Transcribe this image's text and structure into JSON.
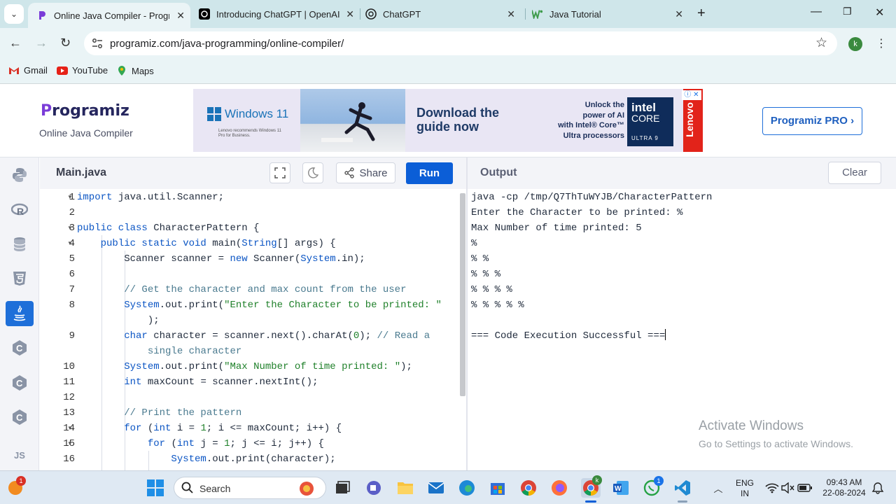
{
  "browser": {
    "tabs": [
      {
        "title": "Online Java Compiler - Program",
        "active": true
      },
      {
        "title": "Introducing ChatGPT | OpenAI",
        "active": false
      },
      {
        "title": "ChatGPT",
        "active": false
      },
      {
        "title": "Java Tutorial",
        "active": false
      }
    ],
    "url": "programiz.com/java-programming/online-compiler/",
    "profile_initial": "k",
    "bookmarks": [
      "Gmail",
      "YouTube",
      "Maps"
    ]
  },
  "site": {
    "logo_text": "rogramiz",
    "logo_letter": "P",
    "subtitle": "Online Java Compiler",
    "pro_button": "Programiz PRO ›",
    "ad": {
      "brand": "Windows 11",
      "brand_sub": "Lenovo recommends Windows 11 Pro for Business.",
      "headline_1": "Download the",
      "headline_2": "guide now",
      "intel_lines": [
        "Unlock the",
        "power of AI",
        "with Intel® Core™",
        "Ultra processors"
      ],
      "intel_logo_1": "intel",
      "intel_logo_2": "CORE",
      "intel_logo_3": "ULTRA 9",
      "lenovo": "Lenovo"
    }
  },
  "editor": {
    "filename": "Main.java",
    "share_label": "Share",
    "run_label": "Run",
    "line_numbers": [
      "1",
      "2",
      "3",
      "4",
      "5",
      "6",
      "7",
      "8",
      "",
      "9",
      "",
      "10",
      "11",
      "12",
      "13",
      "14",
      "15",
      "16"
    ]
  },
  "output": {
    "title": "Output",
    "clear_label": "Clear",
    "lines": [
      "java -cp /tmp/Q7ThTuWYJB/CharacterPattern",
      "Enter the Character to be printed: %",
      "Max Number of time printed: 5",
      "%",
      "% %",
      "% % %",
      "% % % %",
      "% % % % %",
      "",
      "=== Code Execution Successful ==="
    ],
    "watermark_1": "Activate Windows",
    "watermark_2": "Go to Settings to activate Windows."
  },
  "taskbar": {
    "search_placeholder": "Search",
    "language_1": "ENG",
    "language_2": "IN",
    "time": "09:43 AM",
    "date": "22-08-2024",
    "notif_badge": "1",
    "whatsapp_badge": "1",
    "chrome_profile_badge": "k"
  },
  "rail": {
    "js_label": "JS"
  },
  "colors": {
    "accent": "#0b5ed7",
    "chrome_tabbar": "#cfe6ea",
    "keyword": "#0b55c4",
    "string": "#20812b",
    "comment": "#4a7a8f"
  }
}
